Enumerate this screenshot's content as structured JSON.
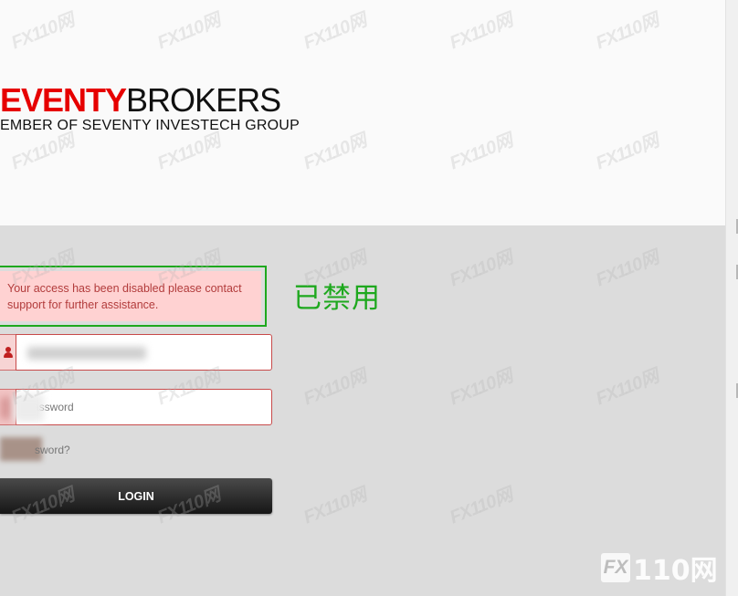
{
  "brand": {
    "logo_red": "EVENTY",
    "logo_black": "BROKERS",
    "tagline": "EMBER OF SEVENTY INVESTECH GROUP"
  },
  "alert": {
    "message": "Your access has been disabled please contact support for further assistance."
  },
  "annotation": {
    "text": "已禁用"
  },
  "login_form": {
    "username_icon": "user-icon",
    "password_placeholder": "Password",
    "forgot_label": "sword?",
    "login_label": "LOGIN"
  },
  "watermark": {
    "badge_box": "FX",
    "badge_text": "110网",
    "tile_text": "FX110网"
  },
  "colors": {
    "brand_red": "#e60000",
    "alert_bg": "#ffd2d2",
    "alert_text": "#b23c3c",
    "annotation_green": "#1ea81e",
    "button_dark": "#1a1a1a"
  }
}
